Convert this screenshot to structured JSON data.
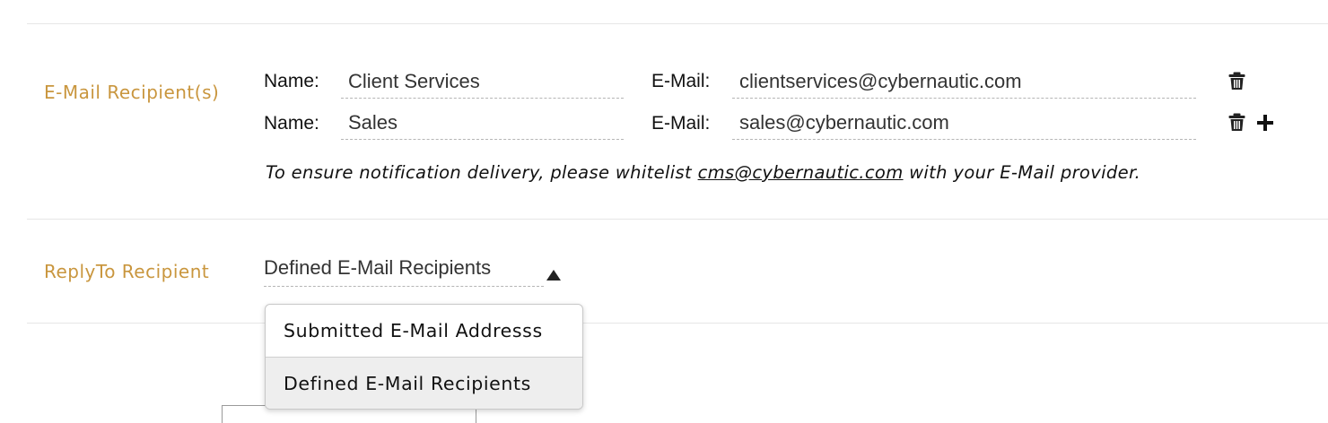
{
  "recipients_section": {
    "label": "E-Mail Recipient(s)",
    "name_label": "Name:",
    "email_label": "E-Mail:",
    "rows": [
      {
        "name": "Client Services",
        "email": "clientservices@cybernautic.com",
        "actions": [
          "trash-icon"
        ]
      },
      {
        "name": "Sales",
        "email": "sales@cybernautic.com",
        "actions": [
          "trash-icon",
          "plus-icon"
        ]
      }
    ],
    "note_prefix": "To ensure notification delivery, please whitelist ",
    "note_link": "cms@cybernautic.com",
    "note_suffix": " with your E-Mail provider."
  },
  "replyto_section": {
    "label": "ReplyTo Recipient",
    "selected": "Defined E-Mail Recipients",
    "caret_icon": "caret-up-icon",
    "options": [
      "Submitted E-Mail Addresss",
      "Defined E-Mail Recipients"
    ]
  },
  "colors": {
    "label_accent": "#c9963e",
    "divider": "#e6e6e6"
  }
}
